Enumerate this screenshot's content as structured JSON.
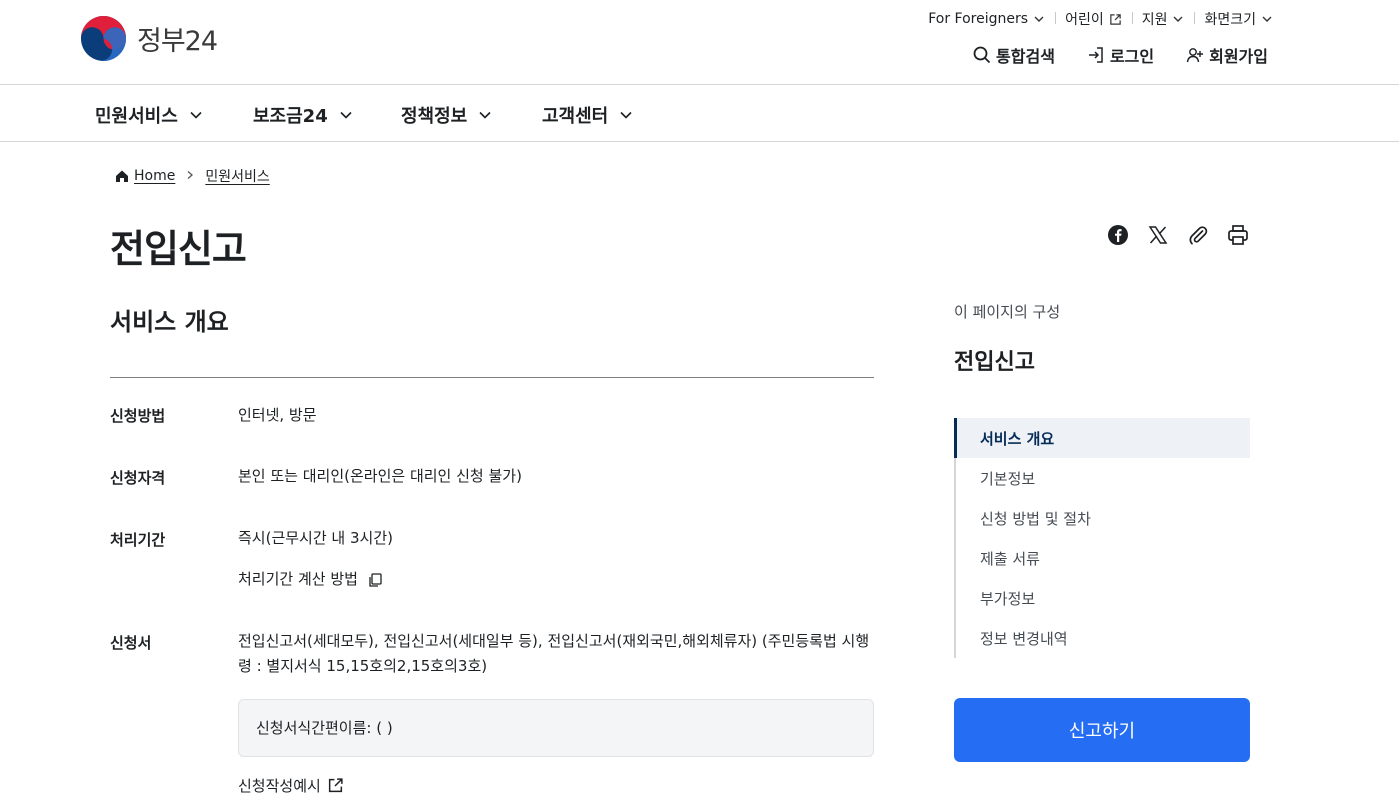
{
  "header": {
    "logo_text": "정부24",
    "util": [
      {
        "label": "For Foreigners",
        "icon": "chevron-down-icon"
      },
      {
        "label": "어린이",
        "icon": "external-link-icon"
      },
      {
        "label": "지원",
        "icon": "chevron-down-icon"
      },
      {
        "label": "화면크기",
        "icon": "chevron-down-icon"
      }
    ],
    "actions": {
      "search": "통합검색",
      "login": "로그인",
      "signup": "회원가입"
    }
  },
  "gnb": [
    "민원서비스",
    "보조금24",
    "정책정보",
    "고객센터"
  ],
  "breadcrumb": {
    "home": "Home",
    "current": "민원서비스"
  },
  "page_title": "전입신고",
  "share_icons": [
    "facebook-icon",
    "x-icon",
    "paperclip-icon",
    "print-icon"
  ],
  "overview": {
    "heading": "서비스 개요",
    "rows": {
      "method": {
        "label": "신청방법",
        "value": "인터넷, 방문"
      },
      "qualification": {
        "label": "신청자격",
        "value": "본인 또는 대리인(온라인은 대리인 신청 불가)"
      },
      "period": {
        "label": "처리기간",
        "value": "즉시(근무시간 내 3시간)",
        "link": "처리기간 계산 방법"
      },
      "form": {
        "label": "신청서",
        "value": "전입신고서(세대모두), 전입신고서(세대일부 등), 전입신고서(재외국민,해외체류자) (주민등록법 시행령 : 별지서식 15,15호의2,15호의3호)",
        "note": "신청서식간편이름: ( )",
        "example": "신청작성예시"
      }
    }
  },
  "toc": {
    "caption": "이 페이지의 구성",
    "title": "전입신고",
    "items": [
      "서비스 개요",
      "기본정보",
      "신청 방법 및 절차",
      "제출 서류",
      "부가정보",
      "정보 변경내역"
    ],
    "active_index": 0
  },
  "report_button": "신고하기",
  "colors": {
    "primary": "#256ef4",
    "navy": "#052b57",
    "text": "#1e2124",
    "toc_active_bg": "#eef2f7"
  }
}
